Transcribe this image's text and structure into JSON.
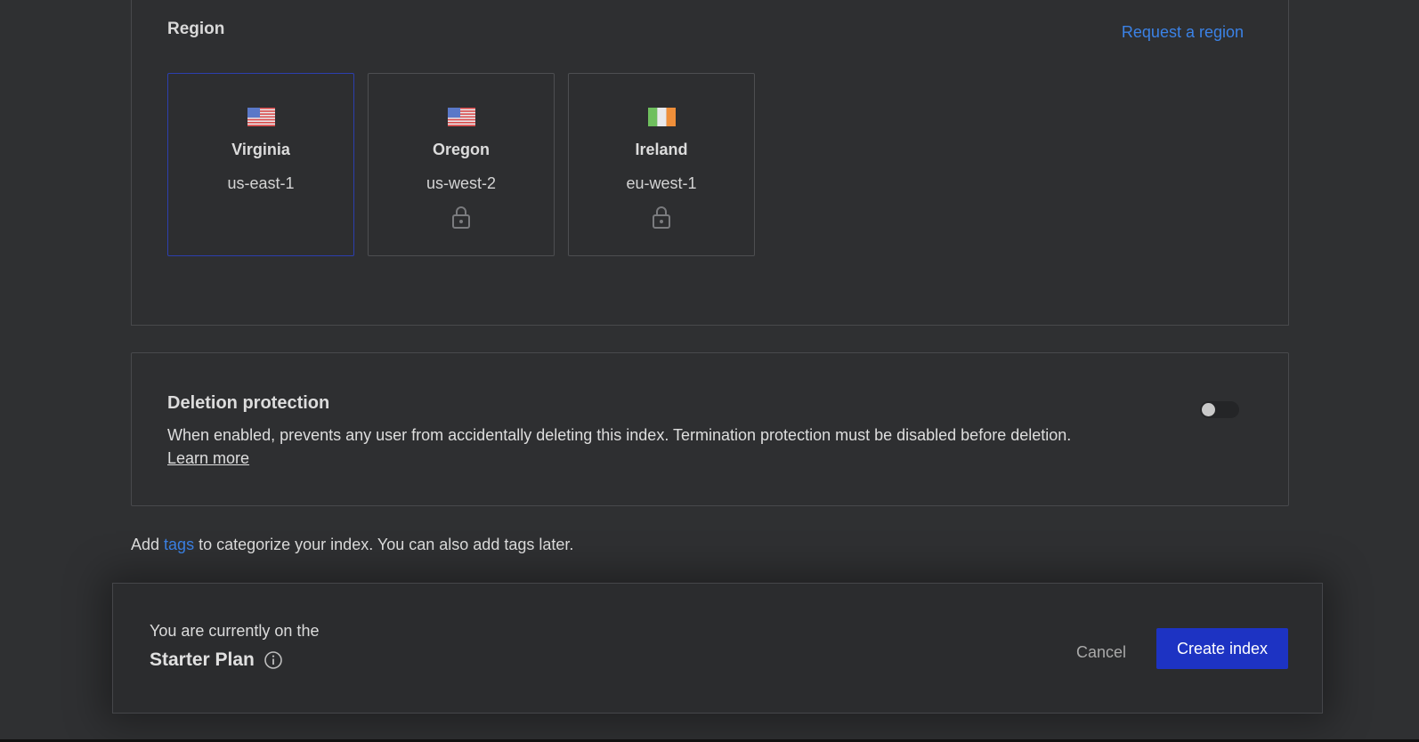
{
  "region": {
    "title": "Region",
    "request_link": "Request a region",
    "tiles": [
      {
        "name": "Virginia",
        "code": "us-east-1",
        "flag": "us-flag-icon",
        "locked": false,
        "selected": true
      },
      {
        "name": "Oregon",
        "code": "us-west-2",
        "flag": "us-flag-icon",
        "locked": true,
        "selected": false
      },
      {
        "name": "Ireland",
        "code": "eu-west-1",
        "flag": "ireland-flag-icon",
        "locked": true,
        "selected": false
      }
    ]
  },
  "deletion": {
    "title": "Deletion protection",
    "description": "When enabled, prevents any user from accidentally deleting this index. Termination protection must be disabled before deletion.",
    "learn_more": "Learn more",
    "enabled": false
  },
  "tags": {
    "prefix": "Add",
    "link": "tags",
    "suffix": "to categorize your index. You can also add tags later."
  },
  "footer": {
    "plan_prefix": "You are currently on the",
    "plan_name": "Starter Plan",
    "cancel_label": "Cancel",
    "create_label": "Create index"
  },
  "colors": {
    "background": "#2f3032",
    "accent_link": "#3b82e6",
    "primary_button": "#1d33c3",
    "selected_border": "#2c3fae"
  }
}
